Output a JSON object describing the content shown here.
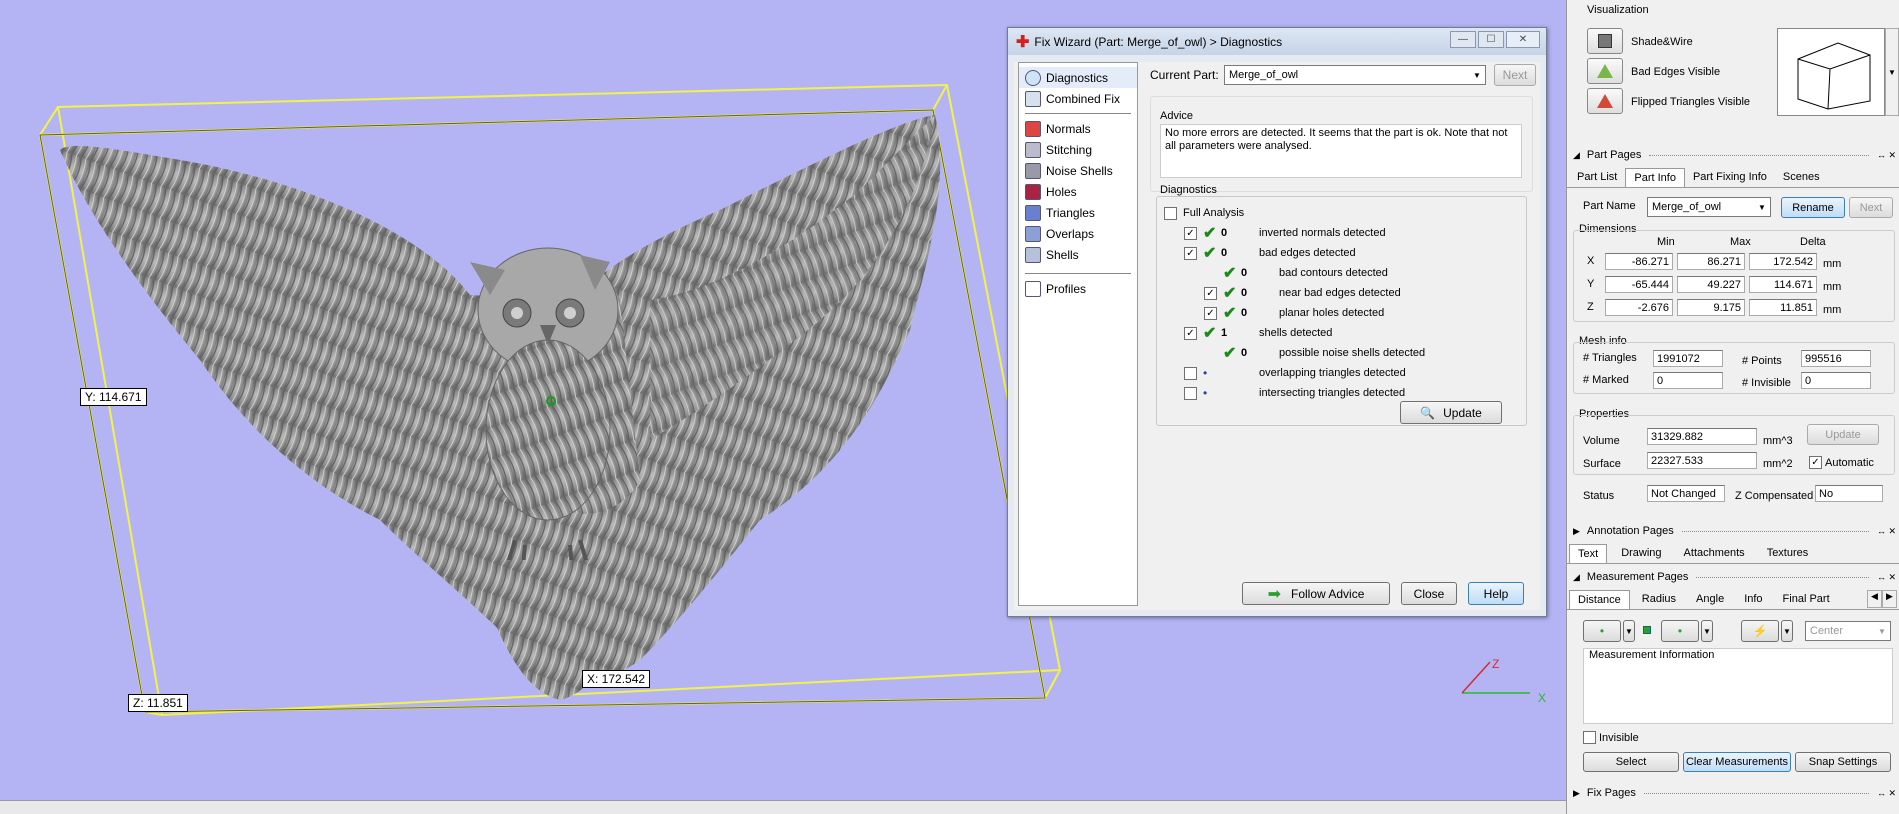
{
  "viewport": {
    "dim_y": "Y: 114.671",
    "dim_z": "Z: 11.851",
    "dim_x": "X: 172.542",
    "axis_z": "Z",
    "axis_x": "X"
  },
  "wizard": {
    "title": "Fix Wizard (Part: Merge_of_owl) > Diagnostics",
    "nav": [
      "Diagnostics",
      "Combined Fix",
      "Normals",
      "Stitching",
      "Noise Shells",
      "Holes",
      "Triangles",
      "Overlaps",
      "Shells",
      "Profiles"
    ],
    "current_part_label": "Current Part:",
    "current_part": "Merge_of_owl",
    "next_label": "Next",
    "advice_title": "Advice",
    "advice_text": "No more errors are detected. It seems that the part is ok. Note that not all parameters were analysed.",
    "diagnostics_title": "Diagnostics",
    "full_analysis": "Full Analysis",
    "rows": [
      {
        "count": "0",
        "label": "inverted normals detected"
      },
      {
        "count": "0",
        "label": "bad edges detected"
      },
      {
        "count": "0",
        "label": "bad contours detected"
      },
      {
        "count": "0",
        "label": "near bad edges detected"
      },
      {
        "count": "0",
        "label": "planar holes detected"
      },
      {
        "count": "1",
        "label": "shells detected"
      },
      {
        "count": "0",
        "label": "possible noise shells detected"
      },
      {
        "count": "",
        "label": "overlapping triangles detected"
      },
      {
        "count": "",
        "label": "intersecting triangles detected"
      }
    ],
    "update_label": "Update",
    "follow_advice_label": "Follow Advice",
    "close_label": "Close",
    "help_label": "Help"
  },
  "panel": {
    "visualization_title": "Visualization",
    "vis_options": [
      "Shade&Wire",
      "Bad Edges Visible",
      "Flipped Triangles Visible"
    ],
    "part_pages_title": "Part Pages",
    "part_tabs": [
      "Part List",
      "Part Info",
      "Part Fixing Info",
      "Scenes"
    ],
    "part_name_label": "Part Name",
    "part_name": "Merge_of_owl",
    "rename_label": "Rename",
    "next_label": "Next",
    "dimensions_title": "Dimensions",
    "dim_headers": [
      "Min",
      "Max",
      "Delta"
    ],
    "dims": [
      {
        "axis": "X",
        "min": "-86.271",
        "max": "86.271",
        "delta": "172.542",
        "unit": "mm"
      },
      {
        "axis": "Y",
        "min": "-65.444",
        "max": "49.227",
        "delta": "114.671",
        "unit": "mm"
      },
      {
        "axis": "Z",
        "min": "-2.676",
        "max": "9.175",
        "delta": "11.851",
        "unit": "mm"
      }
    ],
    "mesh_title": "Mesh info",
    "triangles_label": "# Triangles",
    "triangles": "1991072",
    "points_label": "# Points",
    "points": "995516",
    "marked_label": "# Marked",
    "marked": "0",
    "invisible_label": "# Invisible",
    "invisible": "0",
    "properties_title": "Properties",
    "volume_label": "Volume",
    "volume": "31329.882",
    "volume_unit": "mm^3",
    "surface_label": "Surface",
    "surface": "22327.533",
    "surface_unit": "mm^2",
    "update_label": "Update",
    "automatic_label": "Automatic",
    "status_label": "Status",
    "status": "Not Changed",
    "zcomp_label": "Z Compensated",
    "zcomp": "No",
    "annotation_title": "Annotation Pages",
    "annotation_tabs": [
      "Text",
      "Drawing",
      "Attachments",
      "Textures"
    ],
    "measurement_title": "Measurement Pages",
    "measurement_tabs": [
      "Distance",
      "Radius",
      "Angle",
      "Info",
      "Final Part"
    ],
    "center_label": "Center",
    "measurement_info": "Measurement Information",
    "invisible_chk": "Invisible",
    "select_label": "Select",
    "clear_label": "Clear Measurements",
    "snap_label": "Snap Settings",
    "fix_pages_title": "Fix Pages"
  }
}
